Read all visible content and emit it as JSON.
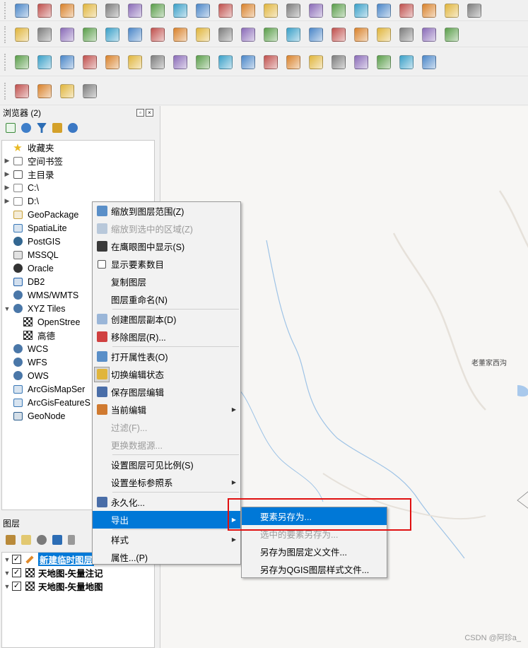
{
  "toolbars": {
    "row1": [
      "new-project-icon",
      "open-project-icon",
      "save-project-icon",
      "save-as-icon",
      "layout-icon",
      "style-manager-icon",
      "pan-icon",
      "pan-to-selection-icon",
      "zoom-in-icon",
      "zoom-out-icon",
      "zoom-full-icon",
      "zoom-to-selection-icon",
      "zoom-to-layer-icon",
      "zoom-native-icon",
      "zoom-last-icon",
      "zoom-next-icon",
      "new-map-view-icon",
      "temporal-icon",
      "bookmark-icon",
      "refresh-icon",
      "identify-icon"
    ],
    "row2": [
      "data-source-manager-icon",
      "new-layer-icon",
      "digitize-icon",
      "pencil-icon",
      "gps-icon",
      "node-tool-icon",
      "current-edits-icon",
      "toggle-editing-icon",
      "save-edits-icon",
      "vertex-tool-icon",
      "add-feature-icon",
      "delete-icon",
      "cut-icon",
      "copy-icon",
      "paste-icon",
      "undo-icon",
      "redo-icon",
      "label-icon",
      "diagram-icon",
      "label-pin-icon"
    ],
    "row3": [
      "advanced-digitize-icon",
      "shape-digitize-icon",
      "move-feature-icon",
      "rotate-feature-icon",
      "simplify-icon",
      "add-ring-icon",
      "add-part-icon",
      "fill-ring-icon",
      "delete-ring-icon",
      "delete-part-icon",
      "reshape-icon",
      "offset-curve-icon",
      "split-features-icon",
      "split-parts-icon",
      "merge-features-icon",
      "merge-attributes-icon",
      "rotate-point-icon",
      "magnet-icon",
      "snapping-tracing-icon"
    ],
    "row4": [
      "layer-styling-icon",
      "processing-toolbox-icon",
      "locate-icon",
      "fullscreen-icon"
    ]
  },
  "browser": {
    "title": "浏览器 (2)",
    "items": [
      {
        "label": "收藏夹",
        "icon": "star-icon",
        "expand": false
      },
      {
        "label": "空间书签",
        "icon": "bookmark-icon",
        "expand": true
      },
      {
        "label": "主目录",
        "icon": "home-icon",
        "expand": true
      },
      {
        "label": "C:\\",
        "icon": "drive-icon",
        "expand": true
      },
      {
        "label": "D:\\",
        "icon": "drive-icon",
        "expand": true
      },
      {
        "label": "GeoPackage",
        "icon": "geopackage-icon",
        "expand": false
      },
      {
        "label": "SpatiaLite",
        "icon": "spatialite-icon",
        "expand": false
      },
      {
        "label": "PostGIS",
        "icon": "postgis-icon",
        "expand": false
      },
      {
        "label": "MSSQL",
        "icon": "mssql-icon",
        "expand": false
      },
      {
        "label": "Oracle",
        "icon": "oracle-icon",
        "expand": false
      },
      {
        "label": "DB2",
        "icon": "db2-icon",
        "expand": false
      },
      {
        "label": "WMS/WMTS",
        "icon": "globe-icon",
        "expand": false
      },
      {
        "label": "XYZ Tiles",
        "icon": "globe-icon",
        "expand": "open"
      },
      {
        "label": "OpenStree",
        "icon": "tile-icon",
        "indent": true
      },
      {
        "label": "高德",
        "icon": "tile-icon",
        "indent": true
      },
      {
        "label": "WCS",
        "icon": "globe-icon",
        "expand": false
      },
      {
        "label": "WFS",
        "icon": "globe-icon",
        "expand": false
      },
      {
        "label": "OWS",
        "icon": "globe-icon",
        "expand": false
      },
      {
        "label": "ArcGisMapSer",
        "icon": "arcgis-icon",
        "expand": false
      },
      {
        "label": "ArcGisFeatureS",
        "icon": "arcgis-icon",
        "expand": false
      },
      {
        "label": "GeoNode",
        "icon": "geonode-icon",
        "expand": false
      }
    ]
  },
  "layers_panel": {
    "title": "图层",
    "layers": [
      {
        "name": "新建临时图层",
        "checked": true,
        "selected": true
      },
      {
        "name": "天地图-矢量注记",
        "checked": true,
        "selected": false
      },
      {
        "name": "天地图-矢量地图",
        "checked": true,
        "selected": false
      }
    ]
  },
  "context_menu": {
    "items": [
      {
        "label": "缩放到图层范围(Z)",
        "icon": "zoom-layer-icon",
        "enabled": true
      },
      {
        "label": "缩放到选中的区域(Z)",
        "icon": "zoom-selection-icon",
        "enabled": false
      },
      {
        "label": "在鹰眼图中显示(S)",
        "icon": "overview-icon",
        "enabled": true
      },
      {
        "label": "显示要素数目",
        "icon": "checkbox-icon",
        "enabled": true
      },
      {
        "label": "复制图层",
        "enabled": true
      },
      {
        "label": "图层重命名(N)",
        "enabled": true,
        "sep_after": true
      },
      {
        "label": "创建图层副本(D)",
        "icon": "duplicate-icon",
        "enabled": true
      },
      {
        "label": "移除图层(R)...",
        "icon": "remove-layer-icon",
        "enabled": true,
        "sep_after": true
      },
      {
        "label": "打开属性表(O)",
        "icon": "attribute-table-icon",
        "enabled": true
      },
      {
        "label": "切换编辑状态",
        "icon": "toggle-edit-icon",
        "enabled": true,
        "active": true
      },
      {
        "label": "保存图层编辑",
        "icon": "save-edit-icon",
        "enabled": true
      },
      {
        "label": "当前编辑",
        "icon": "current-edit-icon",
        "enabled": true,
        "submenu": true
      },
      {
        "label": "过滤(F)...",
        "enabled": false
      },
      {
        "label": "更换数据源...",
        "enabled": false,
        "sep_after": true
      },
      {
        "label": "设置图层可见比例(S)",
        "enabled": true
      },
      {
        "label": "设置坐标参照系",
        "enabled": true,
        "submenu": true,
        "sep_after": true
      },
      {
        "label": "永久化...",
        "icon": "make-permanent-icon",
        "enabled": true
      },
      {
        "label": "导出",
        "enabled": true,
        "submenu": true,
        "highlighted": true,
        "sep_after": true
      },
      {
        "label": "样式",
        "enabled": true,
        "submenu": true
      },
      {
        "label": "属性...(P)",
        "enabled": true
      }
    ]
  },
  "export_submenu": {
    "items": [
      {
        "label": "要素另存为...",
        "enabled": true,
        "highlighted": true
      },
      {
        "label": "选中的要素另存为...",
        "enabled": false
      },
      {
        "label": "另存为图层定义文件...",
        "enabled": true
      },
      {
        "label": "另存为QGIS图层样式文件...",
        "enabled": true
      }
    ]
  },
  "map": {
    "place_label": "老董家西沟"
  },
  "watermark": "CSDN @阿珍a_"
}
